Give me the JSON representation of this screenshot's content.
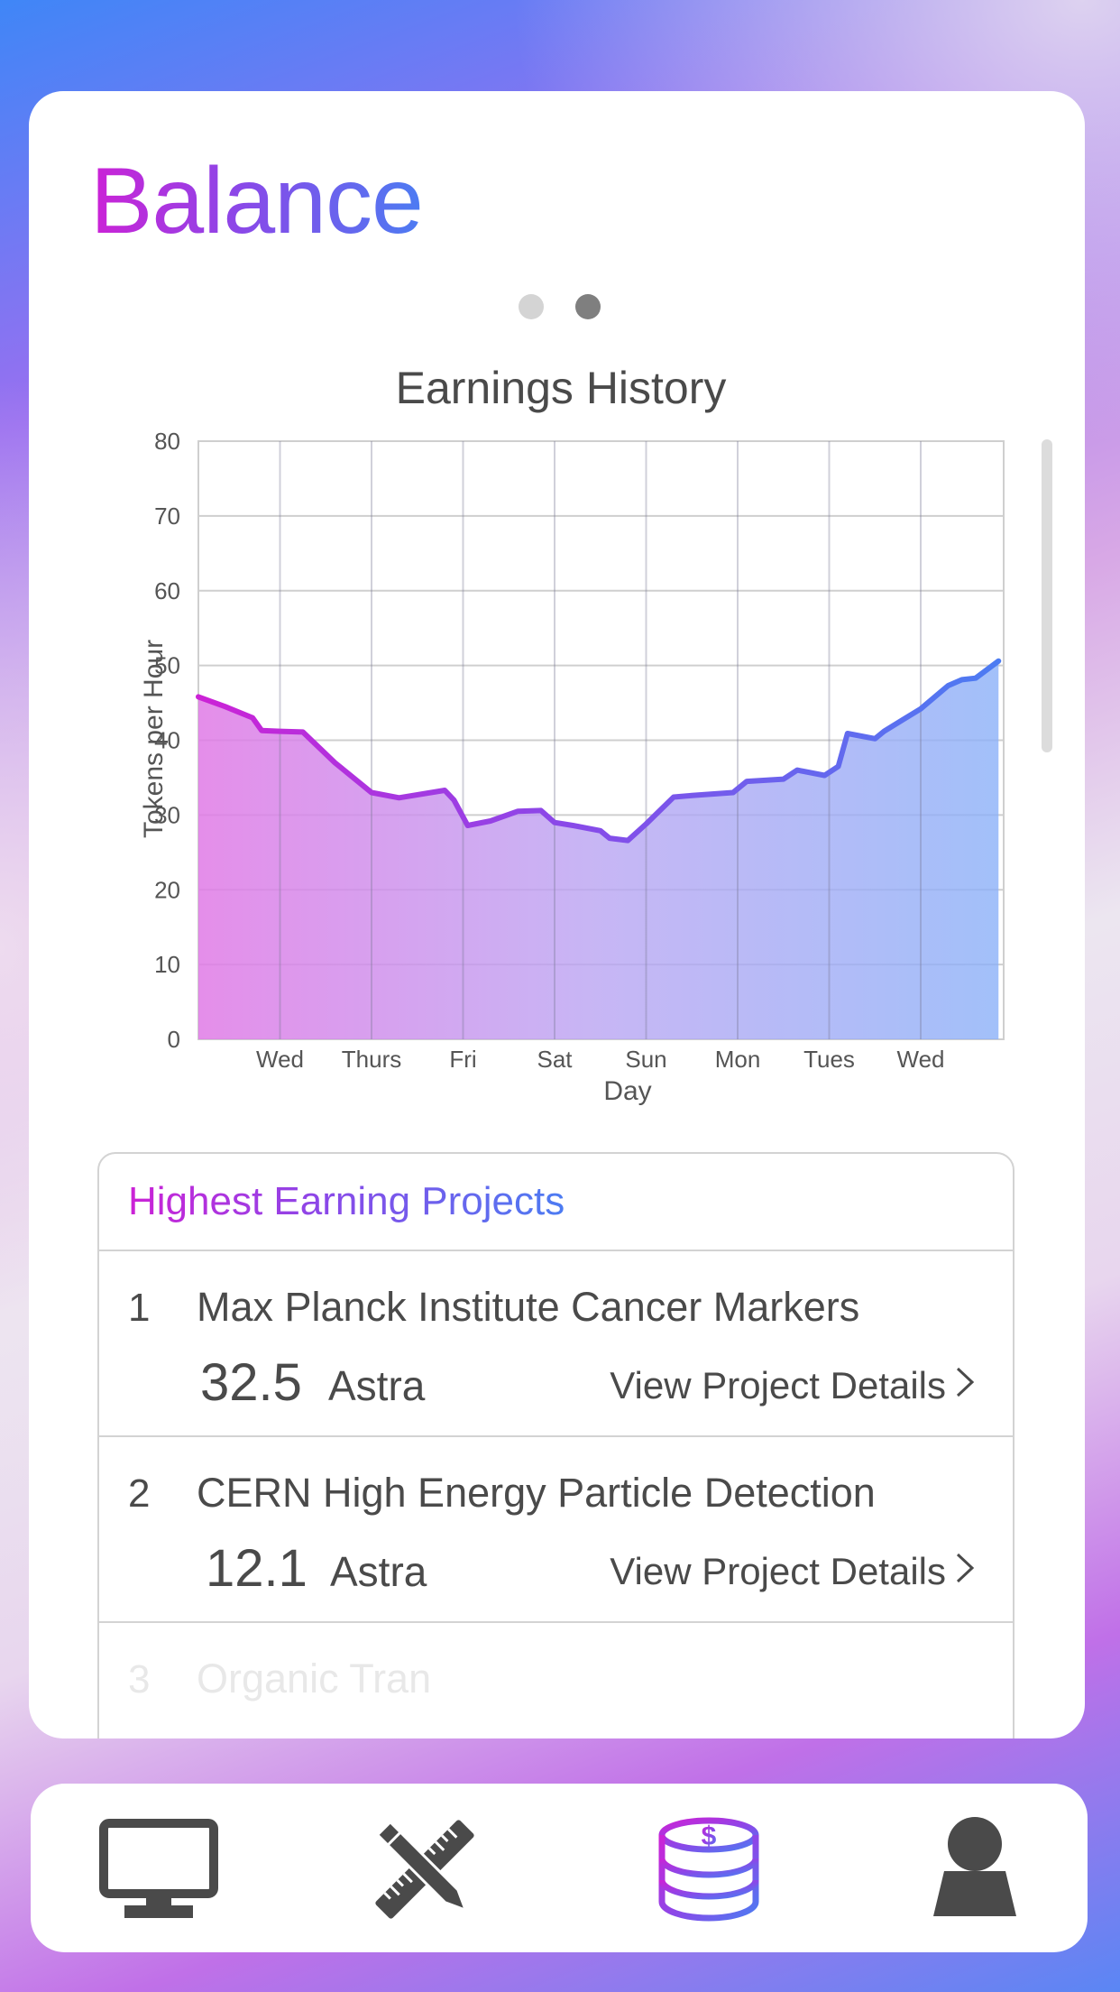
{
  "page": {
    "title": "Balance",
    "pager": {
      "pages": 2,
      "active_index": 1
    }
  },
  "chart": {
    "title": "Earnings History"
  },
  "chart_data": {
    "type": "area",
    "title": "Earnings History",
    "xlabel": "Day",
    "ylabel": "Tokens per Hour",
    "ylim": [
      0,
      80
    ],
    "yticks": [
      0,
      10,
      20,
      30,
      40,
      50,
      60,
      70,
      80
    ],
    "xticks": [
      "Wed",
      "Thurs",
      "Fri",
      "Sat",
      "Sun",
      "Mon",
      "Tues",
      "Wed"
    ],
    "grid": true,
    "x": [
      -0.9,
      -0.6,
      -0.3,
      -0.2,
      0.0,
      0.25,
      0.6,
      1.0,
      1.3,
      1.8,
      1.9,
      2.05,
      2.3,
      2.6,
      2.85,
      3.0,
      3.2,
      3.5,
      3.6,
      3.8,
      4.0,
      4.3,
      4.5,
      4.95,
      5.1,
      5.5,
      5.65,
      5.95,
      6.1,
      6.2,
      6.5,
      6.6,
      6.8,
      7.0,
      7.3,
      7.45,
      7.6,
      7.85
    ],
    "y": [
      45.8,
      44.5,
      43,
      41.3,
      41.2,
      41.1,
      37,
      33,
      32.3,
      33.3,
      32,
      28.6,
      29.2,
      30.5,
      30.6,
      29,
      28.6,
      27.9,
      26.9,
      26.6,
      28.8,
      32.4,
      32.6,
      33,
      34.5,
      34.8,
      36,
      35.3,
      36.5,
      40.9,
      40.2,
      41.2,
      42.7,
      44.2,
      47.3,
      48.1,
      48.3,
      50.6
    ],
    "colors": {
      "start": "#cc22d6",
      "mid": "#8a48e8",
      "end": "#4c7cf2"
    }
  },
  "projects": {
    "header": "Highest Earning Projects",
    "items": [
      {
        "rank": "1",
        "name": "Max Planck Institute Cancer Markers",
        "amount": "32.5",
        "unit": "Astra",
        "link": "View Project Details"
      },
      {
        "rank": "2",
        "name": "CERN High Energy Particle Detection",
        "amount": "12.1",
        "unit": "Astra",
        "link": "View Project Details"
      },
      {
        "rank": "3",
        "name": "Organic Tran",
        "amount": "",
        "unit": "",
        "link": ""
      }
    ]
  },
  "tabbar": {
    "tabs": [
      {
        "icon": "monitor-icon",
        "active": false
      },
      {
        "icon": "design-tools-icon",
        "active": false
      },
      {
        "icon": "coins-icon",
        "active": true
      },
      {
        "icon": "user-icon",
        "active": false
      }
    ]
  },
  "theme": {
    "accent_magenta": "#cc22d6",
    "accent_blue": "#4c7cf2",
    "text": "#4a4a4a"
  }
}
